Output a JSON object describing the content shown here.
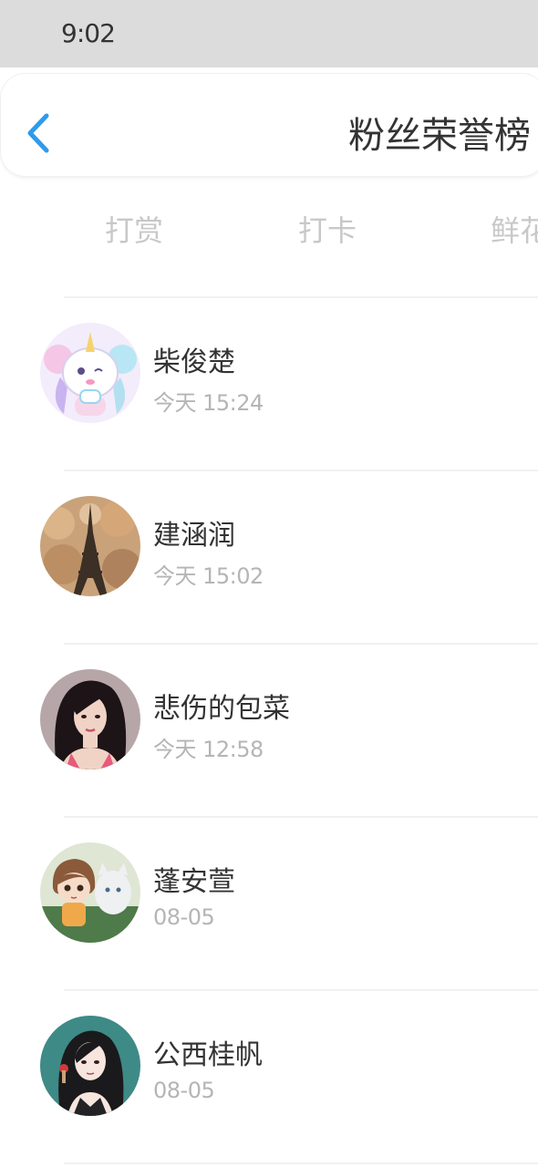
{
  "status_bar": {
    "time": "9:02"
  },
  "header": {
    "back_icon": "chevron-left-icon",
    "title": "粉丝荣誉榜",
    "accent_color": "#2f9bea"
  },
  "tabs": [
    {
      "label": "打赏"
    },
    {
      "label": "打卡"
    },
    {
      "label": "鲜花"
    }
  ],
  "fans": [
    {
      "name": "柴俊楚",
      "time": "今天 15:24",
      "avatar": "unicorn-cartoon-avatar"
    },
    {
      "name": "建涵润",
      "time": "今天 15:02",
      "avatar": "eiffel-tower-avatar"
    },
    {
      "name": "悲伤的包菜",
      "time": "今天 12:58",
      "avatar": "woman-portrait-avatar"
    },
    {
      "name": "蓬安萱",
      "time": "08-05",
      "avatar": "anime-girl-cat-avatar"
    },
    {
      "name": "公西桂帆",
      "time": "08-05",
      "avatar": "anime-girl-long-hair-avatar"
    }
  ]
}
